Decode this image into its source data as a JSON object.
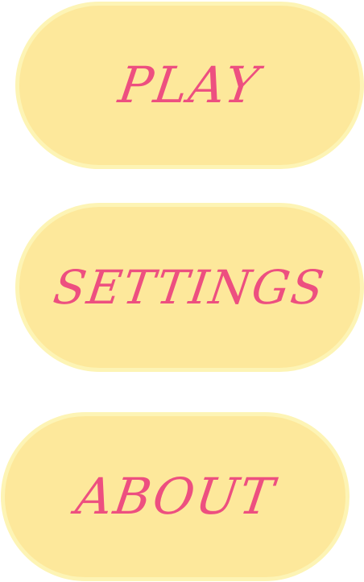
{
  "menu": {
    "play_label": "PLAY",
    "settings_label": "SETTINGS",
    "about_label": "ABOUT"
  },
  "colors": {
    "button_fill": "#fde89b",
    "button_border": "#fdf4b5",
    "label_text": "#ed4f80",
    "background": "#ffffff"
  }
}
